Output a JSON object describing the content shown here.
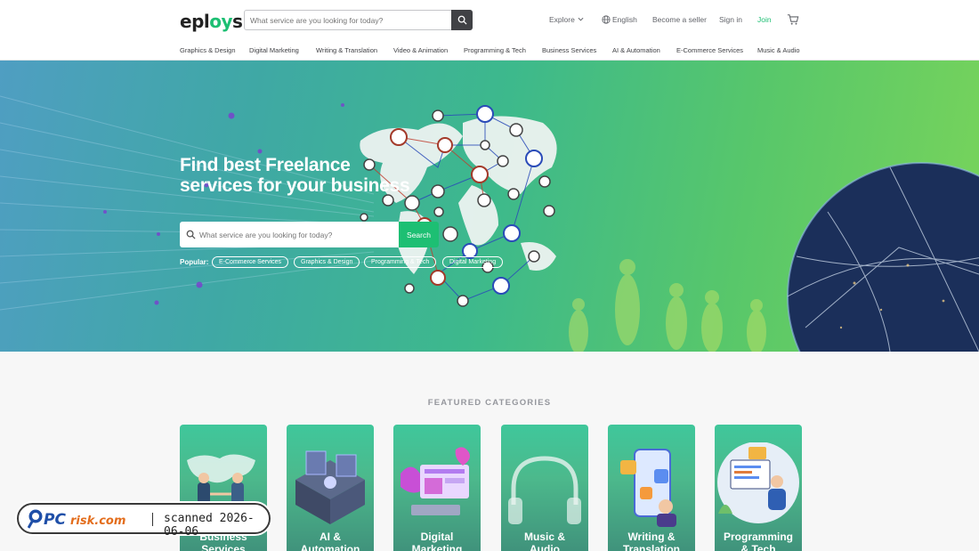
{
  "brand": {
    "name_left": "epl",
    "name_accent": "oy",
    "name_right": "s"
  },
  "header": {
    "search_placeholder": "What service are you looking for today?",
    "explore": "Explore",
    "language": "English",
    "become_seller": "Become a seller",
    "sign_in": "Sign in",
    "join": "Join"
  },
  "categories": [
    "Graphics & Design",
    "Digital Marketing",
    "Writing & Translation",
    "Video & Animation",
    "Programming & Tech",
    "Business Services",
    "AI & Automation",
    "E-Commerce Services",
    "Music & Audio"
  ],
  "hero": {
    "title_line1": "Find best Freelance",
    "title_line2": "services for your business",
    "search_placeholder": "What service are you looking for today?",
    "search_button": "Search",
    "popular_label": "Popular:",
    "popular": [
      "E-Commerce Services",
      "Graphics & Design",
      "Programming & Tech",
      "Digital Marketing"
    ]
  },
  "featured": {
    "title": "FEATURED CATEGORIES",
    "cards": [
      {
        "line1": "Business",
        "line2": "Services"
      },
      {
        "line1": "AI &",
        "line2": "Automation"
      },
      {
        "line1": "Digital",
        "line2": "Marketing"
      },
      {
        "line1": "Music &",
        "line2": "Audio"
      },
      {
        "line1": "Writing &",
        "line2": "Translation"
      },
      {
        "line1": "Programming",
        "line2": "& Tech"
      }
    ]
  },
  "watermark": {
    "brand_pc": "PC",
    "brand_rest": "risk.com",
    "text": "scanned 2026-06-06"
  },
  "colors": {
    "accent": "#1dbf73",
    "dark": "#404145"
  },
  "icons": [
    "search-icon",
    "chevron-down-icon",
    "globe-icon",
    "cart-icon",
    "magnifier-logo-icon"
  ]
}
